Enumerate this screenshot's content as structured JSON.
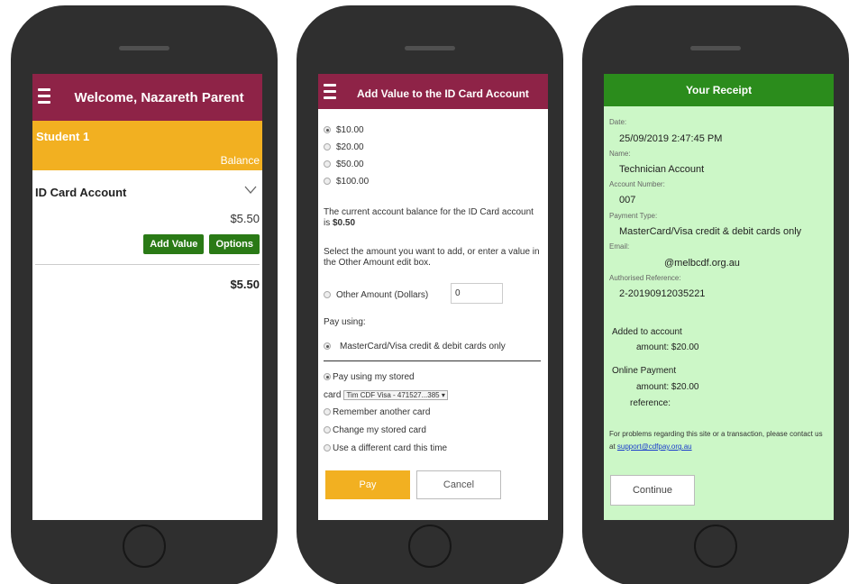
{
  "phone1": {
    "header": {
      "title": "Welcome, Nazareth Parent"
    },
    "student": {
      "name": "Student 1",
      "balance_label": "Balance"
    },
    "account": {
      "name": "ID Card Account",
      "amount": "$5.50"
    },
    "buttons": {
      "add_value": "Add Value",
      "options": "Options"
    },
    "total": "$5.50"
  },
  "phone2": {
    "header": {
      "title": "Add Value to the ID Card Account"
    },
    "amount_options": [
      "$10.00",
      "$20.00",
      "$50.00",
      "$100.00"
    ],
    "balance_text_prefix": "The current account balance for the ID Card account is ",
    "balance_value": "$0.50",
    "instruction": "Select the amount you want to add, or enter a value in the Other Amount edit box.",
    "other_amount_label": "Other Amount (Dollars)",
    "other_amount_value": "0",
    "pay_using_label": "Pay using:",
    "payment_method": "MasterCard/Visa credit & debit cards only",
    "stored_card_label": "Pay using my stored",
    "card_label": "card",
    "card_select_value": "Tim CDF Visa - 471527...385 ▾",
    "remember_card": "Remember another card",
    "change_card": "Change my stored card",
    "different_card": "Use a different card this time",
    "pay_button": "Pay",
    "cancel_button": "Cancel"
  },
  "phone3": {
    "header": {
      "title": "Your Receipt"
    },
    "date_label": "Date:",
    "date_value": "25/09/2019 2:47:45 PM",
    "name_label": "Name:",
    "name_value": "Technician Account",
    "account_number_label": "Account Number:",
    "account_number_value": "007",
    "payment_type_label": "Payment Type:",
    "payment_type_value": "MasterCard/Visa credit & debit cards only",
    "email_label": "Email:",
    "email_value": "@melbcdf.org.au",
    "reference_label": "Authorised Reference:",
    "reference_value": "2-20190912035221",
    "added_to_account": "Added to account",
    "added_amount": "amount: $20.00",
    "online_payment": "Online Payment",
    "online_amount": "amount: $20.00",
    "online_reference": "reference:",
    "contact_text": "For problems regarding this site or a transaction, please contact us at ",
    "contact_email": "support@cdfpay.org.au",
    "continue_button": "Continue"
  },
  "colors": {
    "maroon": "#8e2347",
    "gold": "#f2b021",
    "green": "#2b8c1c",
    "receipt_bg": "#ccf7c7"
  }
}
